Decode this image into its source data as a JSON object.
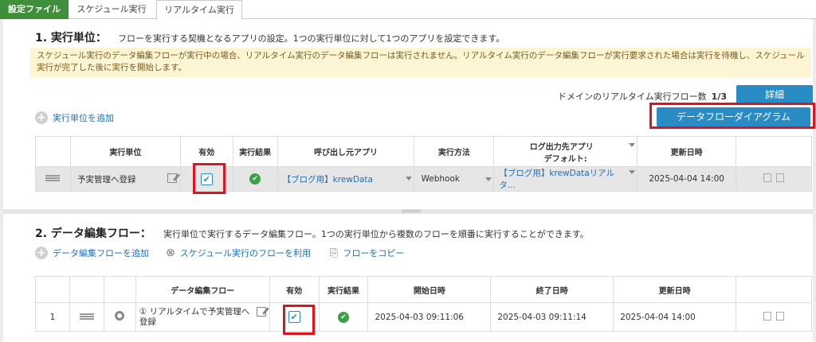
{
  "tabs": [
    {
      "label": "設定ファイル"
    },
    {
      "label": "スケジュール実行"
    },
    {
      "label": "リアルタイム実行"
    }
  ],
  "section1": {
    "title": "1. 実行単位：",
    "desc": "フローを実行する契機となるアプリの設定。1つの実行単位に対して1つのアプリを設定できます。",
    "notice": "スケジュール実行のデータ編集フローが実行中の場合、リアルタイム実行のデータ編集フローは実行されません。リアルタイム実行のデータ編集フローが実行要求された場合は実行を待機し、スケジュール実行が完了した後に実行を開始します。",
    "count_label": "ドメインのリアルタイム実行フロー数",
    "count_value": "1/3",
    "detail_button": "詳細",
    "add_link": "実行単位を追加",
    "dfd_button": "データフローダイアグラム",
    "headers": {
      "unit": "実行単位",
      "enabled": "有効",
      "result": "実行結果",
      "caller_app": "呼び出し元アプリ",
      "method": "実行方法",
      "log_app_1": "ログ出力先アプリ",
      "log_app_2": "デフォルト:",
      "updated": "更新日時"
    },
    "row": {
      "unit": "予実管理へ登録",
      "caller_app": "【ブログ用】krewData",
      "method": "Webhook",
      "log_app": "【ブログ用】krewDataリアルタ...",
      "updated": "2025-04-04 14:00"
    }
  },
  "section2": {
    "title": "2. データ編集フロー：",
    "desc": "実行単位で実行するデータ編集フロー。1つの実行単位から複数のフローを順番に実行することができます。",
    "add_link": "データ編集フローを追加",
    "schedule_link": "スケジュール実行のフローを利用",
    "copy_link": "フローをコピー",
    "headers": {
      "flow": "データ編集フロー",
      "enabled": "有効",
      "result": "実行結果",
      "start": "開始日時",
      "end": "終了日時",
      "updated": "更新日時"
    },
    "row": {
      "no": "1",
      "flow": "① リアルタイムで予実管理へ登録",
      "start": "2025-04-03 09:11:06",
      "end": "2025-04-03 09:11:14",
      "updated": "2025-04-04 14:00"
    }
  },
  "colors": {
    "accent": "#2a8cc4",
    "tab_green": "#3f8e3a",
    "highlight": "#e0121e",
    "notice_bg": "#fdf5d4"
  }
}
